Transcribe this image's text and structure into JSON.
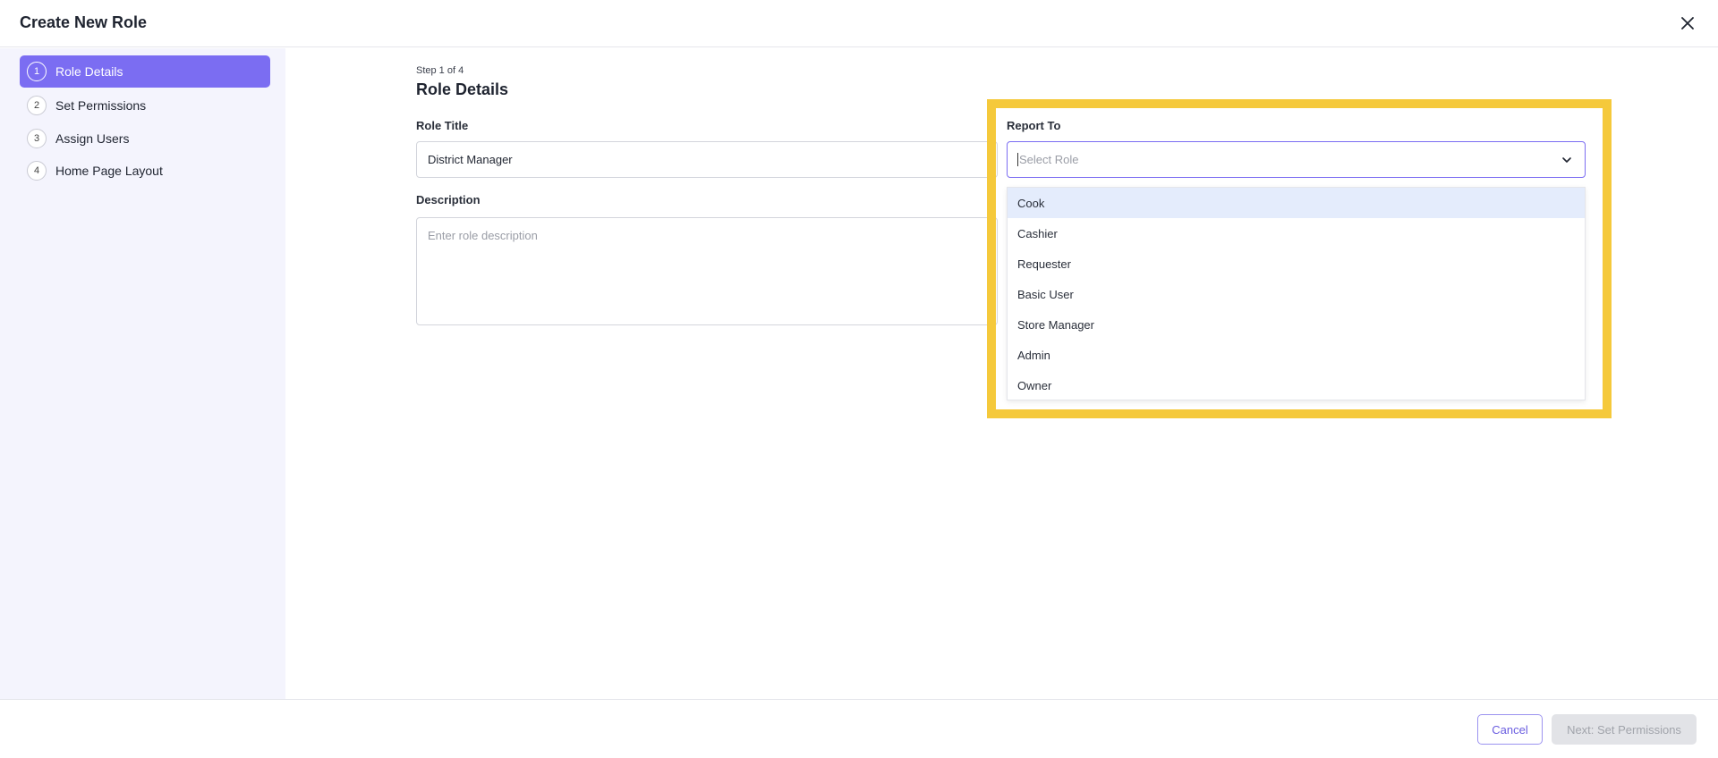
{
  "header": {
    "title": "Create New Role"
  },
  "sidebar": {
    "steps": [
      {
        "number": "1",
        "label": "Role Details",
        "active": true
      },
      {
        "number": "2",
        "label": "Set Permissions",
        "active": false
      },
      {
        "number": "3",
        "label": "Assign Users",
        "active": false
      },
      {
        "number": "4",
        "label": "Home Page Layout",
        "active": false
      }
    ]
  },
  "main": {
    "step_counter": "Step 1 of 4",
    "section_title": "Role Details",
    "role_title": {
      "label": "Role Title",
      "value": "District Manager"
    },
    "description": {
      "label": "Description",
      "placeholder": "Enter role description"
    },
    "report_to": {
      "label": "Report To",
      "placeholder": "Select Role",
      "options": [
        "Cook",
        "Cashier",
        "Requester",
        "Basic User",
        "Store Manager",
        "Admin",
        "Owner"
      ],
      "hovered_option": "Cook"
    }
  },
  "footer": {
    "cancel_label": "Cancel",
    "next_label": "Next: Set Permissions"
  },
  "colors": {
    "accent": "#7b6df2",
    "highlight": "#f5c93b",
    "sidebar_bg": "#f4f4fd",
    "option_hover": "#e4ecfc"
  },
  "icons": {
    "close": "close-icon",
    "dropdown": "chevron-down-icon"
  }
}
